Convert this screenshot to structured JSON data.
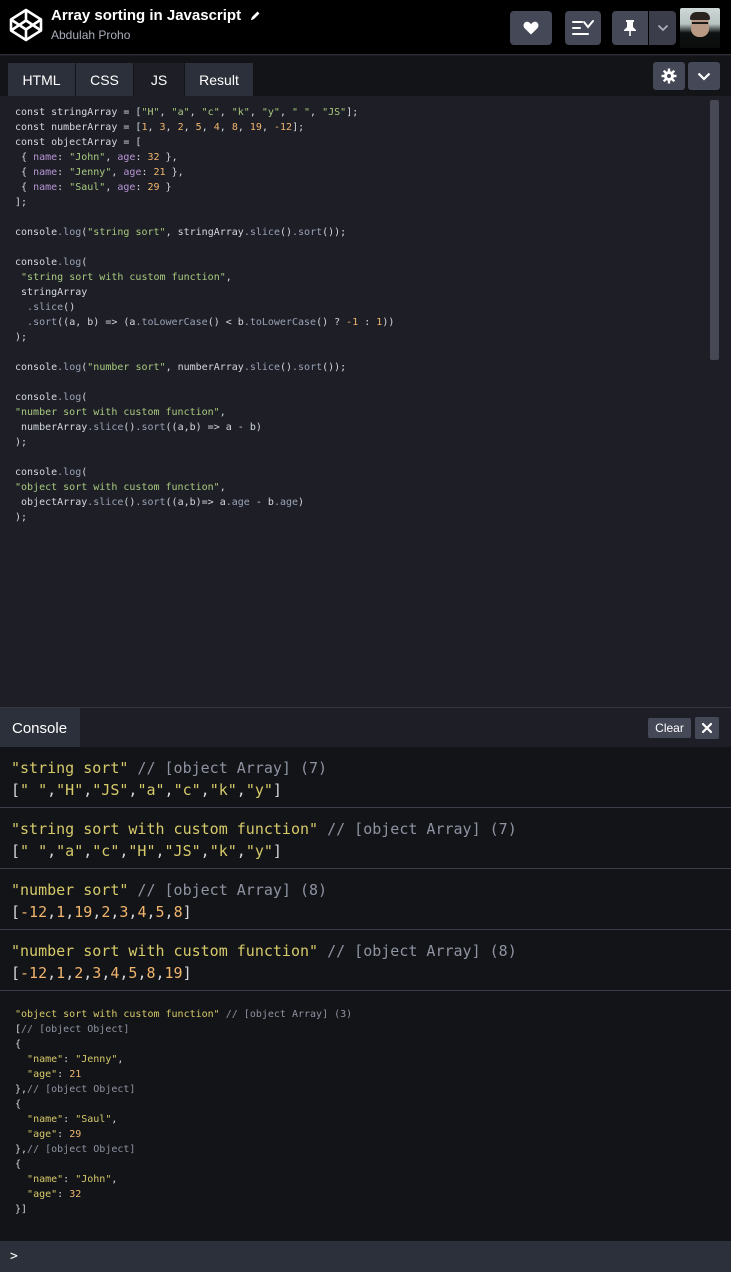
{
  "header": {
    "title": "Array sorting in Javascript",
    "author": "Abdulah Proho",
    "icons": [
      "codepen-logo-icon",
      "pencil-icon",
      "heart-icon",
      "layout-icon",
      "pin-icon",
      "chevron-down-icon",
      "avatar"
    ]
  },
  "tabs": {
    "html": "HTML",
    "css": "CSS",
    "js": "JS",
    "result": "Result",
    "active": "JS"
  },
  "editor": {
    "lines": [
      "const stringArray = [\"H\", \"a\", \"c\", \"k\", \"y\", \" \", \"JS\"];",
      "const numberArray = [1, 3, 2, 5, 4, 8, 19, -12];",
      "const objectArray = [",
      " { name: \"John\", age: 32 },",
      " { name: \"Jenny\", age: 21 },",
      " { name: \"Saul\", age: 29 }",
      "];",
      "",
      "console.log(\"string sort\", stringArray.slice().sort());",
      "",
      "console.log(",
      " \"string sort with custom function\",",
      " stringArray",
      "  .slice()",
      "  .sort((a, b) => (a.toLowerCase() < b.toLowerCase() ? -1 : 1))",
      ");",
      "",
      "console.log(\"number sort\", numberArray.slice().sort());",
      "",
      "console.log(",
      "\"number sort with custom function\",",
      " numberArray.slice().sort((a,b) => a - b)",
      ");",
      "",
      "console.log(",
      "\"object sort with custom function\",",
      " objectArray.slice().sort((a,b)=> a.age - b.age)",
      ");"
    ]
  },
  "console": {
    "title": "Console",
    "clear_label": "Clear",
    "logs": [
      {
        "label": "\"string sort\"",
        "comment": " // [object Array] (7)",
        "value": "[\" \",\"H\",\"JS\",\"a\",\"c\",\"k\",\"y\"]"
      },
      {
        "label": "\"string sort with custom function\"",
        "comment": " // [object Array] (7)",
        "value": "[\" \",\"a\",\"c\",\"H\",\"JS\",\"k\",\"y\"]"
      },
      {
        "label": "\"number sort\"",
        "comment": " // [object Array] (8)",
        "value": "[-12,1,19,2,3,4,5,8]"
      },
      {
        "label": "\"number sort with custom function\"",
        "comment": " // [object Array] (8)",
        "value": "[-12,1,2,3,4,5,8,19]"
      }
    ],
    "object_log": [
      "\"object sort with custom function\" // [object Array] (3)",
      "[// [object Object]",
      "{",
      "  \"name\": \"Jenny\",",
      "  \"age\": 21",
      "},// [object Object]",
      "{",
      "  \"name\": \"Saul\",",
      "  \"age\": 29",
      "},// [object Object]",
      "{",
      "  \"name\": \"John\",",
      "  \"age\": 32",
      "}]"
    ],
    "prompt": ">"
  }
}
